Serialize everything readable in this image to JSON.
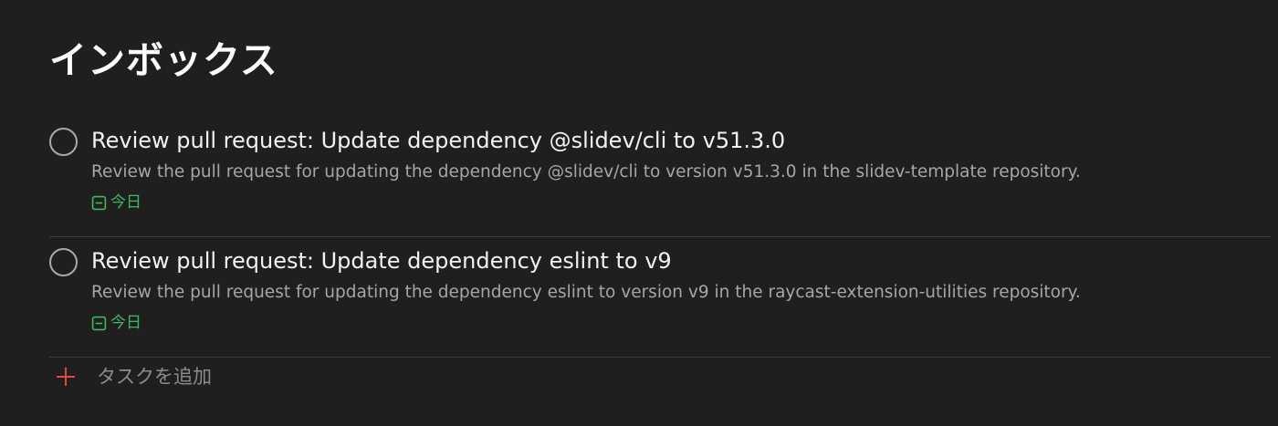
{
  "header": {
    "title": "インボックス"
  },
  "tasks": [
    {
      "title": "Review pull request: Update dependency @slidev/cli to v51.3.0",
      "description": "Review the pull request for updating the dependency @slidev/cli to version v51.3.0 in the slidev-template repository.",
      "due": "今日",
      "due_icon": "calendar-icon",
      "completed": false
    },
    {
      "title": "Review pull request: Update dependency eslint to v9",
      "description": "Review the pull request for updating the dependency eslint to version v9 in the raycast-extension-utilities repository.",
      "due": "今日",
      "due_icon": "calendar-icon",
      "completed": false
    }
  ],
  "add_task": {
    "label": "タスクを追加",
    "icon": "plus-icon"
  },
  "colors": {
    "background": "#1f1f1f",
    "accent": "#db4c3f",
    "due_today": "#3fb863",
    "divider": "#3a3a3a"
  }
}
